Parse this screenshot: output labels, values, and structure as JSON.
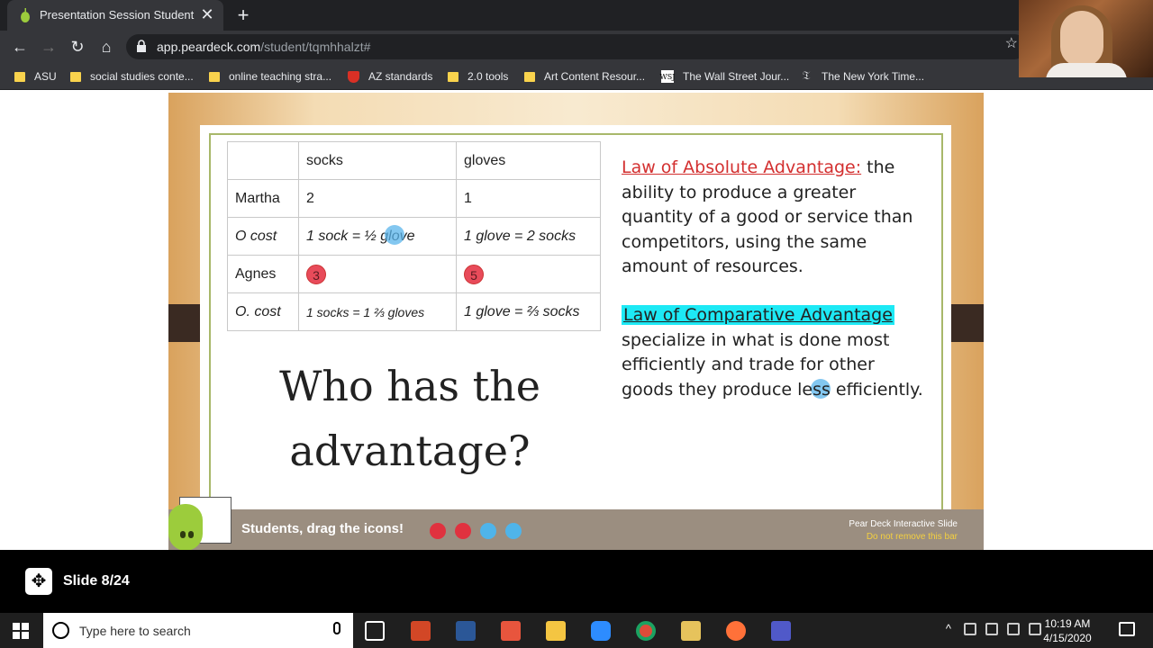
{
  "browser": {
    "tab_title": "Presentation Session Student",
    "tab_close": "✕",
    "new_tab": "+",
    "url_domain": "app.peardeck.com",
    "url_path": "/student/tqmhhalzt#",
    "bookmarks": [
      {
        "label": "ASU",
        "icon": "folder"
      },
      {
        "label": "social studies conte...",
        "icon": "folder"
      },
      {
        "label": "online teaching stra...",
        "icon": "folder"
      },
      {
        "label": "AZ standards",
        "icon": "shield"
      },
      {
        "label": "2.0 tools",
        "icon": "folder"
      },
      {
        "label": "Art Content Resour...",
        "icon": "folder"
      },
      {
        "label": "The Wall Street Jour...",
        "icon": "wsj"
      },
      {
        "label": "The New York Time...",
        "icon": "nyt"
      }
    ]
  },
  "slide": {
    "table": {
      "headers": [
        "",
        "socks",
        "gloves"
      ],
      "rows": [
        [
          "Martha",
          "2",
          "1"
        ],
        [
          "O cost",
          "1 sock = ½ glove",
          "1 glove = 2 socks"
        ],
        [
          "Agnes",
          "3",
          "5"
        ],
        [
          "O. cost",
          "1 socks = 1 ⅔ gloves",
          "1 glove = ⅔ socks"
        ]
      ]
    },
    "question": "Who has the advantage?",
    "law_absolute": {
      "heading": "Law of Absolute Advantage:",
      "body": " the ability to produce a greater quantity of a good or service than competitors, using the same amount of resources."
    },
    "law_comparative": {
      "heading": "Law of Comparative Advantage",
      "body": "specialize in what is done most efficiently and trade for other goods they produce less efficiently."
    },
    "drag_prompt": "Students, drag the icons!",
    "pear_label": "Pear Deck Interactive Slide",
    "pear_sublabel": "Do not remove this bar",
    "colors": {
      "red_icon": "#e0323f",
      "blue_icon": "#4fb4ea",
      "highlight": "#1de9f5",
      "law_red": "#d32f2f"
    }
  },
  "footer": {
    "slide_counter": "Slide 8/24"
  },
  "taskbar": {
    "search_placeholder": "Type here to search",
    "time": "10:19 AM",
    "date": "4/15/2020"
  }
}
